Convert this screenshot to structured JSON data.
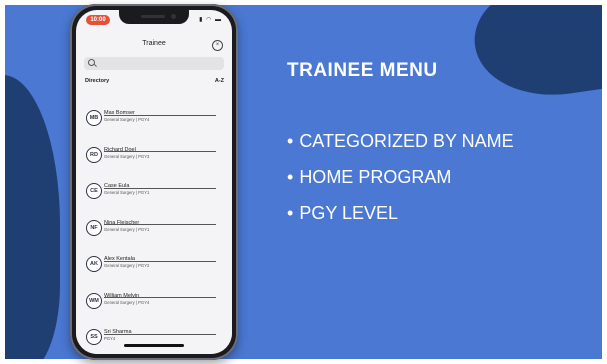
{
  "phone": {
    "status_time": "10:00",
    "status_icons": "▮ ◠ ▬",
    "title": "Trainee",
    "close_icon_glyph": "×",
    "directory_label": "Directory",
    "sort_label": "A-Z",
    "trainees": [
      {
        "initials": "MB",
        "name": "Max  Bomser",
        "detail": "General Surgery | PGY4"
      },
      {
        "initials": "RD",
        "name": "Richard  Doel",
        "detail": "General Surgery | PGY3"
      },
      {
        "initials": "CE",
        "name": "Case  Eula",
        "detail": "General Surgery | PGY1"
      },
      {
        "initials": "NF",
        "name": "Nina  Fleischer",
        "detail": "General Surgery | PGY1"
      },
      {
        "initials": "AK",
        "name": "Alex  Kentala",
        "detail": "General Surgery | PGY2"
      },
      {
        "initials": "WM",
        "name": "William  Melvin",
        "detail": "General Surgery | PGY4"
      },
      {
        "initials": "SS",
        "name": "Sri  Sharma",
        "detail": "PGY4"
      }
    ]
  },
  "slide": {
    "heading": "TRAINEE MENU",
    "bullet_glyph": "•",
    "bullets": [
      "CATEGORIZED BY NAME",
      "HOME PROGRAM",
      "PGY LEVEL"
    ]
  },
  "colors": {
    "background_blue": "#4a78d2",
    "blob_navy": "#1f3f73",
    "time_pill": "#e2513a"
  },
  "icons": [
    "search-icon",
    "close-icon"
  ]
}
